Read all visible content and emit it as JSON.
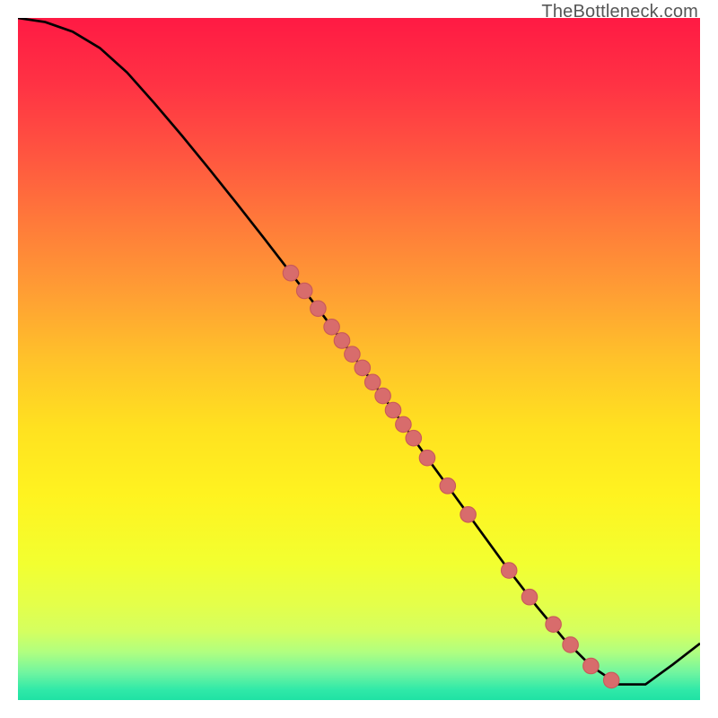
{
  "attribution": "TheBottleneck.com",
  "colors": {
    "curve_stroke": "#000000",
    "point_fill": "#d86c6c",
    "point_stroke": "#c95a5a"
  },
  "gradient_stops": [
    {
      "offset": 0.0,
      "color": "#ff1a44"
    },
    {
      "offset": 0.1,
      "color": "#ff3344"
    },
    {
      "offset": 0.2,
      "color": "#ff5540"
    },
    {
      "offset": 0.3,
      "color": "#ff7a3a"
    },
    {
      "offset": 0.4,
      "color": "#ff9d34"
    },
    {
      "offset": 0.5,
      "color": "#ffc22a"
    },
    {
      "offset": 0.6,
      "color": "#ffe120"
    },
    {
      "offset": 0.7,
      "color": "#fff320"
    },
    {
      "offset": 0.8,
      "color": "#f2ff30"
    },
    {
      "offset": 0.86,
      "color": "#e4ff4a"
    },
    {
      "offset": 0.9,
      "color": "#d4ff60"
    },
    {
      "offset": 0.93,
      "color": "#b0ff80"
    },
    {
      "offset": 0.96,
      "color": "#70f5a0"
    },
    {
      "offset": 0.985,
      "color": "#30e9a8"
    },
    {
      "offset": 1.0,
      "color": "#1fe2a4"
    }
  ],
  "chart_data": {
    "type": "line",
    "title": "",
    "xlabel": "",
    "ylabel": "",
    "xlim": [
      0,
      100
    ],
    "ylim": [
      0,
      100
    ],
    "grid": false,
    "legend": false,
    "curve": {
      "x": [
        0,
        4,
        8,
        12,
        16,
        20,
        24,
        28,
        32,
        36,
        40,
        44,
        48,
        52,
        56,
        60,
        64,
        68,
        72,
        76,
        80,
        84,
        88,
        92,
        96,
        100
      ],
      "y": [
        100.0,
        99.4,
        98.0,
        95.6,
        92.0,
        87.5,
        82.8,
        77.9,
        72.9,
        67.8,
        62.6,
        57.4,
        52.0,
        46.6,
        41.1,
        35.5,
        30.0,
        24.5,
        19.0,
        13.8,
        9.0,
        5.0,
        2.3,
        2.3,
        5.2,
        8.3
      ]
    },
    "points": {
      "x": [
        40,
        42,
        44,
        46,
        47.5,
        49,
        50.5,
        52,
        53.5,
        55,
        56.5,
        58,
        60,
        63,
        66,
        72,
        75,
        78.5,
        81,
        84,
        87
      ],
      "y": [
        62.6,
        60.0,
        57.4,
        54.7,
        52.7,
        50.7,
        48.7,
        46.6,
        44.6,
        42.5,
        40.4,
        38.4,
        35.5,
        31.4,
        27.2,
        19.0,
        15.1,
        11.1,
        8.1,
        5.0,
        2.9
      ]
    }
  }
}
